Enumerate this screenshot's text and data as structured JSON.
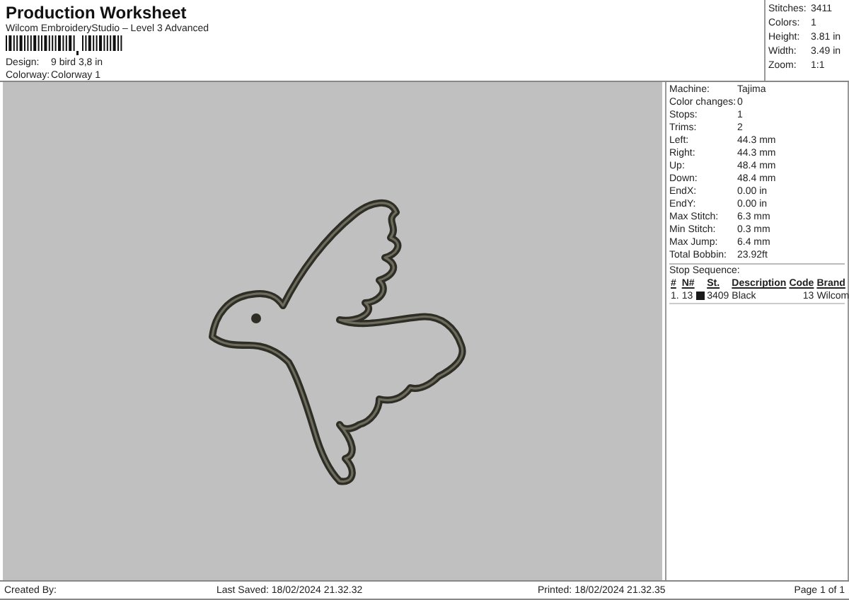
{
  "title": "Production Worksheet",
  "subtitle": "Wilcom EmbroideryStudio – Level 3 Advanced",
  "design_info": [
    {
      "label": "Design:",
      "value": "9 bird 3,8 in"
    },
    {
      "label": "Colorway:",
      "value": "Colorway 1"
    }
  ],
  "summary": [
    {
      "label": "Stitches:",
      "value": "3411"
    },
    {
      "label": "Colors:",
      "value": "1"
    },
    {
      "label": "Height:",
      "value": "3.81 in"
    },
    {
      "label": "Width:",
      "value": "3.49 in"
    },
    {
      "label": "Zoom:",
      "value": "1:1"
    }
  ],
  "machine_info": [
    {
      "label": "Machine:",
      "value": "Tajima"
    },
    {
      "label": "Color changes:",
      "value": "0"
    },
    {
      "label": "Stops:",
      "value": "1"
    },
    {
      "label": "Trims:",
      "value": "2"
    },
    {
      "label": "Left:",
      "value": "44.3 mm"
    },
    {
      "label": "Right:",
      "value": "44.3 mm"
    },
    {
      "label": "Up:",
      "value": "48.4 mm"
    },
    {
      "label": "Down:",
      "value": "48.4 mm"
    },
    {
      "label": "EndX:",
      "value": "0.00 in"
    },
    {
      "label": "EndY:",
      "value": "0.00 in"
    },
    {
      "label": "Max Stitch:",
      "value": "6.3 mm"
    },
    {
      "label": "Min Stitch:",
      "value": "0.3 mm"
    },
    {
      "label": "Max Jump:",
      "value": "6.4 mm"
    },
    {
      "label": "Total Bobbin:",
      "value": "23.92ft"
    }
  ],
  "stop_sequence": {
    "title": "Stop Sequence:",
    "columns": [
      "#",
      "N#",
      "St.",
      "Description",
      "Code",
      "Brand"
    ],
    "rows": [
      {
        "index": "1.",
        "needle": "13",
        "color": "#1a1a1a",
        "stitches": "3409",
        "description": "Black",
        "code": "13",
        "brand": "Wilcom"
      }
    ]
  },
  "footer": {
    "created_by": "Created By:",
    "last_saved": "Last Saved: 18/02/2024 21.32.32",
    "printed": "Printed: 18/02/2024 21.32.35",
    "page": "Page 1 of 1"
  }
}
